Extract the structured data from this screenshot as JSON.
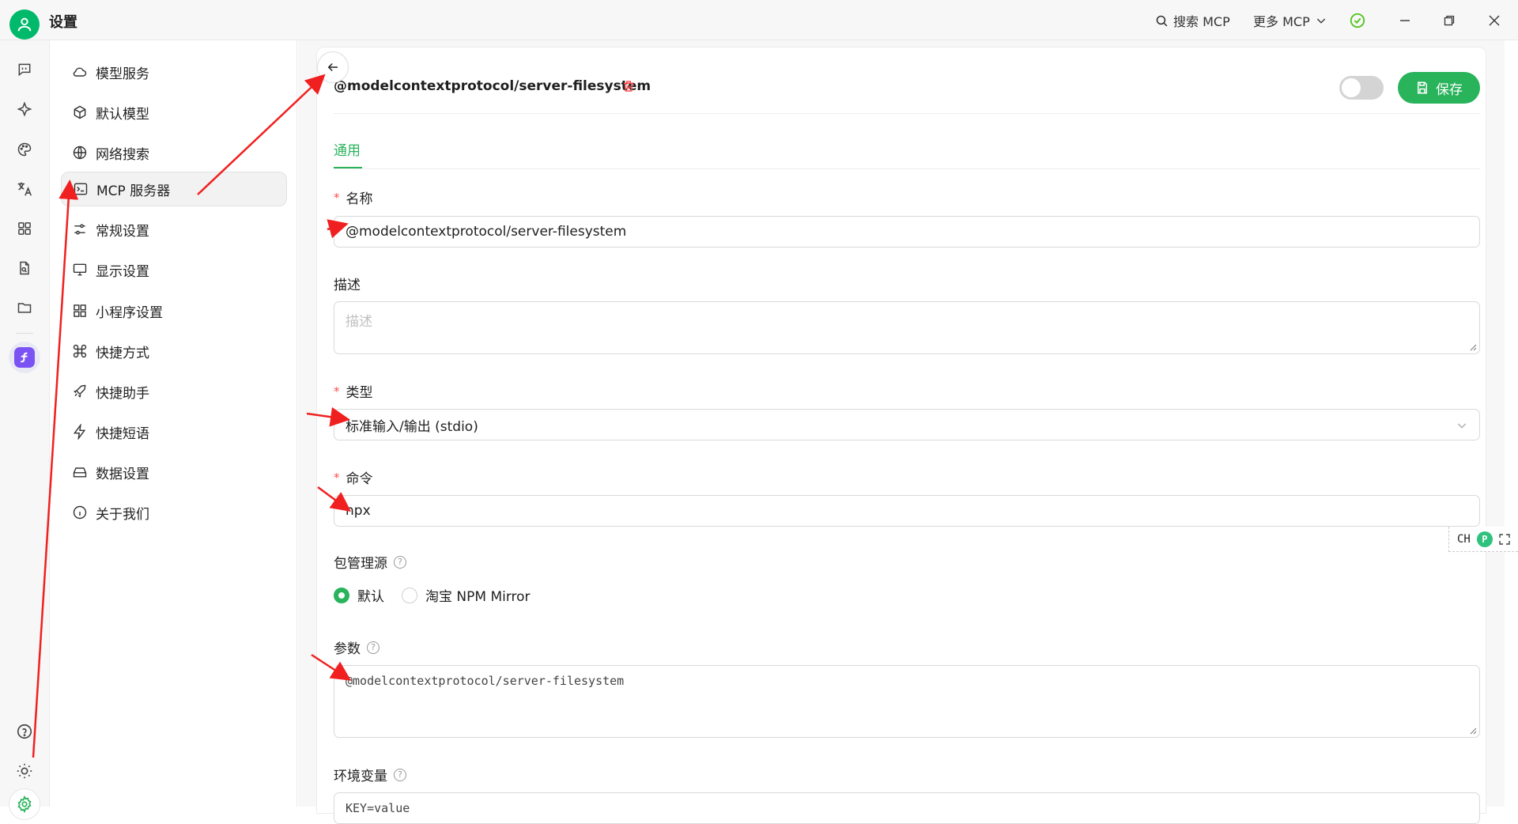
{
  "window": {
    "title": "设置",
    "search_mcp": "搜索 MCP",
    "more_mcp": "更多 MCP"
  },
  "menu": {
    "items": [
      {
        "label": "模型服务",
        "icon": "cloud-icon"
      },
      {
        "label": "默认模型",
        "icon": "cube-icon"
      },
      {
        "label": "网络搜索",
        "icon": "globe-icon"
      },
      {
        "label": "MCP 服务器",
        "icon": "terminal-icon",
        "active": true
      },
      {
        "label": "常规设置",
        "icon": "sliders-icon"
      },
      {
        "label": "显示设置",
        "icon": "monitor-icon"
      },
      {
        "label": "小程序设置",
        "icon": "grid-icon"
      },
      {
        "label": "快捷方式",
        "icon": "command-icon"
      },
      {
        "label": "快捷助手",
        "icon": "rocket-icon"
      },
      {
        "label": "快捷短语",
        "icon": "zap-icon"
      },
      {
        "label": "数据设置",
        "icon": "hard-drive-icon"
      },
      {
        "label": "关于我们",
        "icon": "info-icon"
      }
    ]
  },
  "server": {
    "title": "@modelcontextprotocol/server-filesystem",
    "save_label": "保存",
    "enabled": false
  },
  "tabs": [
    {
      "label": "通用"
    }
  ],
  "form": {
    "name": {
      "label": "名称",
      "value": "@modelcontextprotocol/server-filesystem"
    },
    "description": {
      "label": "描述",
      "placeholder": "描述"
    },
    "type": {
      "label": "类型",
      "value": "标准输入/输出 (stdio)"
    },
    "command": {
      "label": "命令",
      "value": "npx"
    },
    "registry": {
      "label": "包管理源",
      "options": [
        "默认",
        "淘宝 NPM Mirror"
      ],
      "selected": "默认"
    },
    "args": {
      "label": "参数",
      "value": "@modelcontextprotocol/server-filesystem"
    },
    "env": {
      "label": "环境变量",
      "placeholder": "KEY=value"
    }
  },
  "ime": {
    "label": "CH",
    "badge": "P"
  },
  "colors": {
    "accent": "#29b35b",
    "required": "#ff4d4f",
    "arrow": "#f02020"
  }
}
